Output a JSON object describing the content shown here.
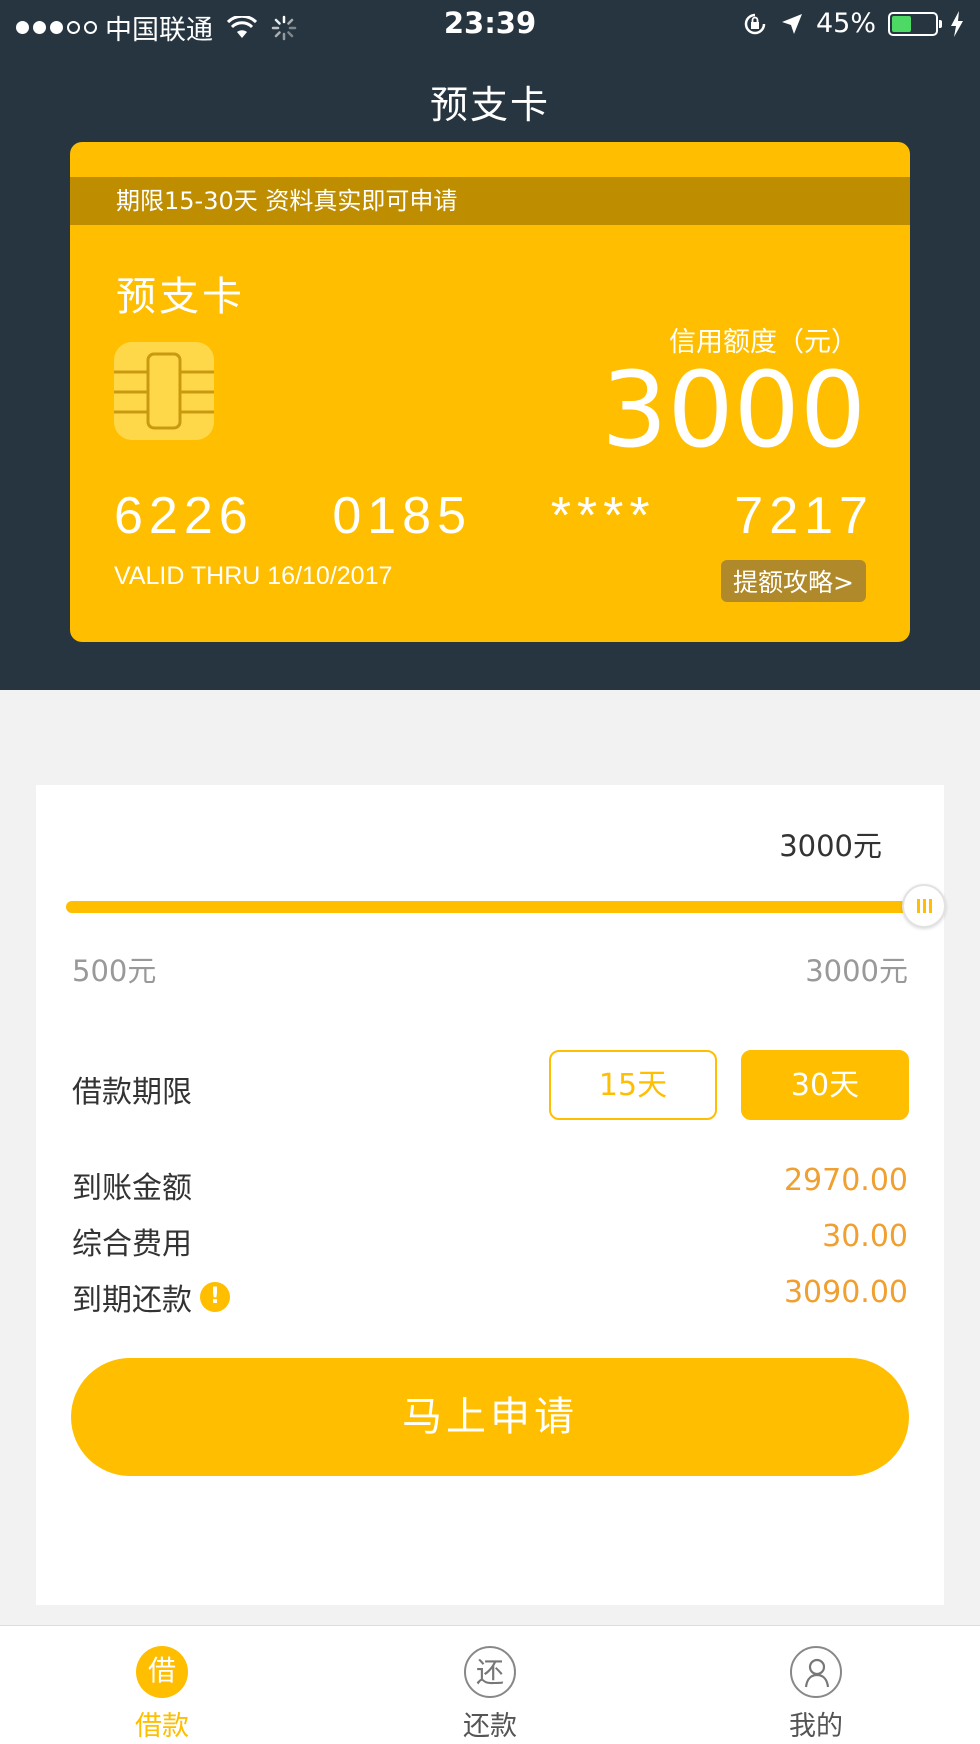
{
  "status_bar": {
    "carrier": "中国联通",
    "time": "23:39",
    "battery_percent": "45%",
    "battery_level": 0.45,
    "signal_bars_filled": 3,
    "signal_bars_total": 5
  },
  "nav": {
    "title": "预支卡"
  },
  "card": {
    "banner": "期限15-30天 资料真实即可申请",
    "name": "预支卡",
    "credit_label": "信用额度（元）",
    "credit_amount": "3000",
    "number_groups": [
      "6226",
      "0185",
      "****",
      "7217"
    ],
    "valid_thru": "VALID THRU 16/10/2017",
    "tips_label": "提额攻略>",
    "colors": {
      "card_bg": "#ffbe00",
      "banner_bg": "#bf8d00",
      "page_top_bg": "#263540"
    }
  },
  "loan": {
    "slider": {
      "current_label": "3000元",
      "min_label": "500元",
      "max_label": "3000元",
      "min": 500,
      "max": 3000,
      "value": 3000
    },
    "term": {
      "label": "借款期限",
      "options": [
        {
          "label": "15天",
          "selected": false
        },
        {
          "label": "30天",
          "selected": true
        }
      ]
    },
    "fees": [
      {
        "label": "到账金额",
        "value": "2970.00"
      },
      {
        "label": "综合费用",
        "value": "30.00"
      },
      {
        "label": "到期还款",
        "value": "3090.00",
        "info_icon": "!"
      }
    ],
    "apply_label": "马上申请",
    "accent_color": "#ffbe00",
    "value_color": "#f0a030"
  },
  "tab_bar": {
    "tabs": [
      {
        "icon_char": "借",
        "label": "借款",
        "active": true
      },
      {
        "icon_char": "还",
        "label": "还款",
        "active": false
      },
      {
        "icon_name": "person-icon",
        "label": "我的",
        "active": false
      }
    ]
  }
}
